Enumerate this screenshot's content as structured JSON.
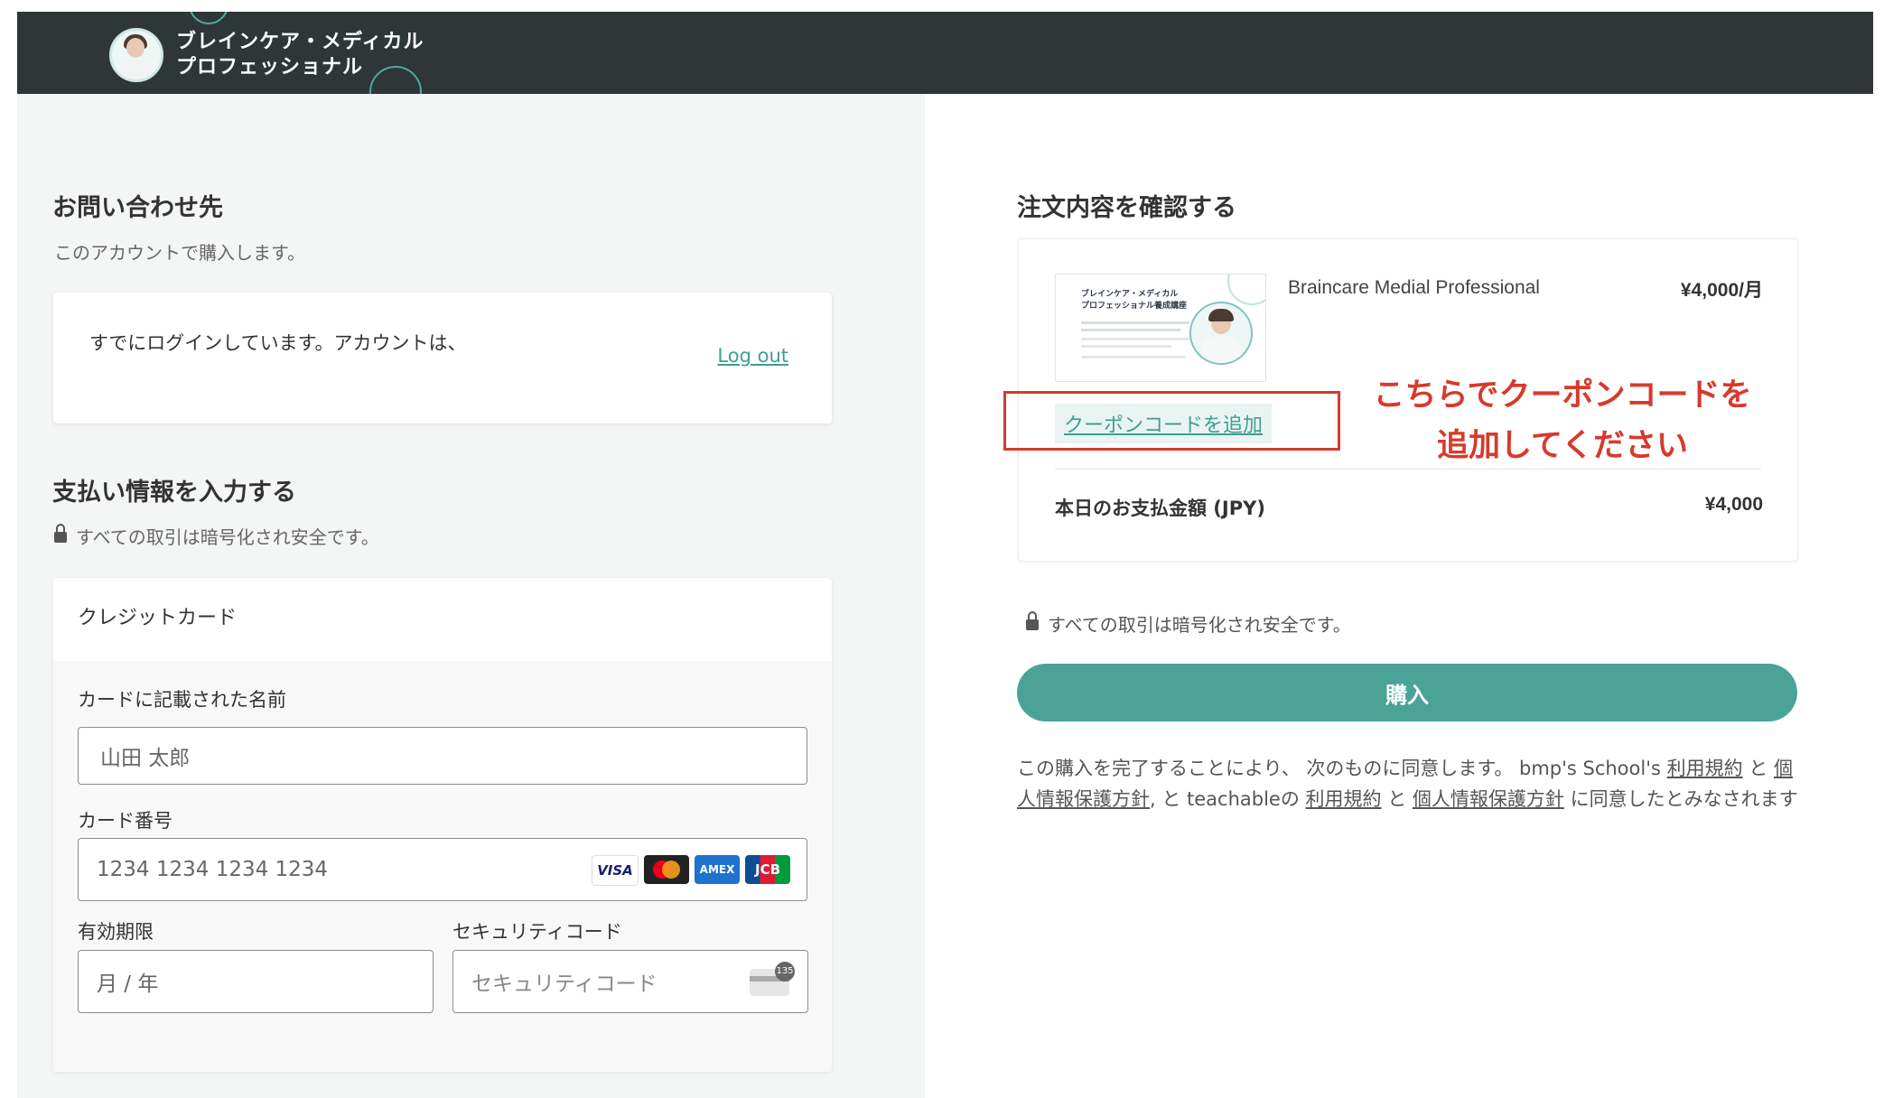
{
  "brand": {
    "line1": "ブレインケア・メディカル",
    "line2": "プロフェッショナル"
  },
  "contact": {
    "title": "お問い合わせ先",
    "subtitle": "このアカウントで購入します。",
    "logged_in_text": "すでにログインしています。アカウントは、",
    "logout_label": "Log out"
  },
  "payment": {
    "title": "支払い情報を入力する",
    "secure_text": "すべての取引は暗号化され安全です。",
    "method_label": "クレジットカード",
    "name_label": "カードに記載された名前",
    "name_placeholder": "山田 太郎",
    "number_label": "カード番号",
    "number_placeholder": "1234 1234 1234 1234",
    "expiry_label": "有効期限",
    "expiry_placeholder": "月 / 年",
    "cvc_label": "セキュリティコード",
    "cvc_placeholder": "セキュリティコード",
    "card_brands": [
      "VISA",
      "AMEX",
      "JCB"
    ],
    "cvc_icon_text": "135"
  },
  "order": {
    "title": "注文内容を確認する",
    "product_name": "Braincare Medial Professional",
    "price": "¥4,000/月",
    "thumb_title_1": "ブレインケア・メディカル",
    "thumb_title_2": "プロフェッショナル養成講座",
    "coupon_label": "クーポンコードを追加",
    "total_label": "本日のお支払金額 (JPY)",
    "total_value": "¥4,000",
    "secure_text": "すべての取引は暗号化され安全です。",
    "buy_label": "購入"
  },
  "annotation": {
    "line1": "こちらでクーポンコードを",
    "line2": "追加してください"
  },
  "terms": {
    "t1": "この購入を完了することにより、 次のものに同意します。 bmp's School's ",
    "link_terms": "利用規約",
    "t2": " と ",
    "link_privacy": "個人情報保護方針",
    "t3": ", と teachableの ",
    "t4": " と ",
    "t5": " に同意したとみなされます"
  },
  "colors": {
    "accent": "#4ba398",
    "header": "#2f3638",
    "annotation": "#d63a2c"
  }
}
